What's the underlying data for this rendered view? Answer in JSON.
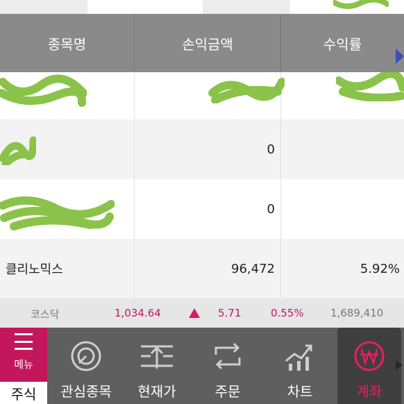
{
  "table": {
    "columns": [
      "종목명",
      "손익금액",
      "수익률"
    ],
    "rows": [
      {
        "name": "",
        "amount": "",
        "rate": ""
      },
      {
        "name": "",
        "amount": "0",
        "rate": ""
      },
      {
        "name": "",
        "amount": "0",
        "rate": ""
      },
      {
        "name": "클리노믹스",
        "amount": "96,472",
        "rate": "5.92%"
      }
    ]
  },
  "ticker": {
    "name": "코스닥",
    "value": "1,034.64",
    "change": "5.71",
    "rate": "0.55%",
    "volume": "1,689,410"
  },
  "nav": {
    "menu_label": "메뉴",
    "stock_tab": "주식",
    "items": [
      "관심종목",
      "현재가",
      "주문",
      "차트",
      "계좌"
    ]
  },
  "colors": {
    "accent": "#c2185b",
    "header_bg": "#8a8a8a",
    "nav_bg": "#5f5f5f"
  }
}
